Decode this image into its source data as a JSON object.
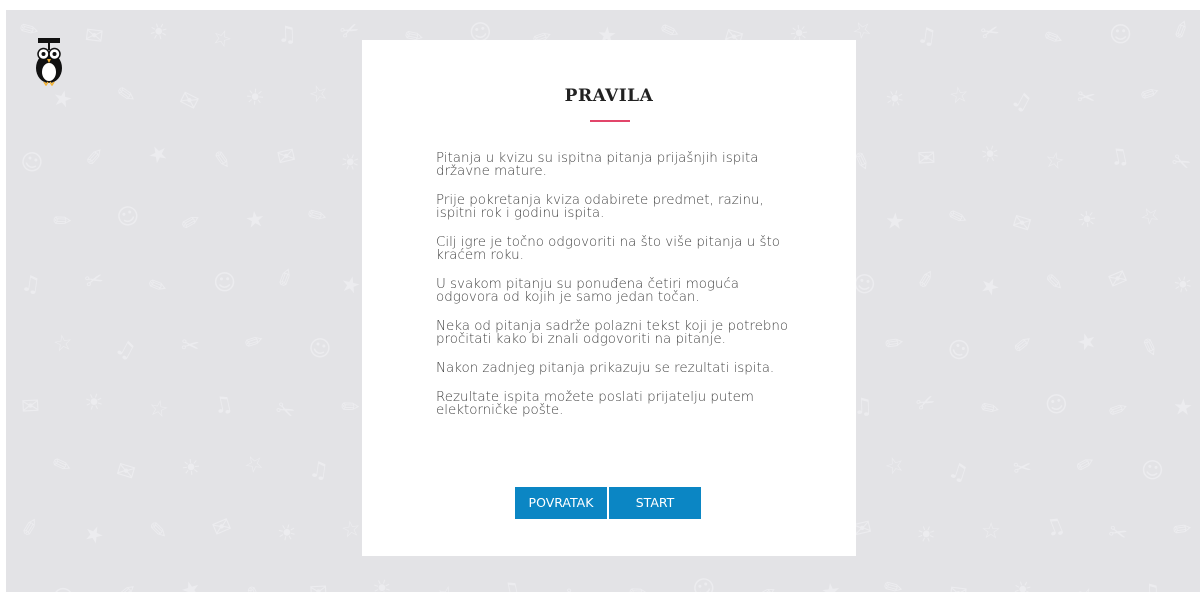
{
  "colors": {
    "background": "#e3e3e6",
    "card": "#ffffff",
    "accent_rule": "#e2456a",
    "button": "#0b86c4",
    "button_text": "#ffffff"
  },
  "logo": {
    "icon": "owl-graduate-icon"
  },
  "background_pattern": {
    "icon": "school-doodles-pattern"
  },
  "rules_panel": {
    "title": "PRAVILA",
    "items": [
      "Pitanja u kvizu su ispitna pitanja prijašnjih ispita državne mature.",
      "Prije pokretanja kviza odabirete predmet, razinu, ispitni rok i godinu ispita.",
      "Cilj igre je točno odgovoriti na što više pitanja u što kraćem roku.",
      "U svakom pitanju su ponuđena četiri moguća odgovora od kojih je samo jedan točan.",
      "Neka od pitanja sadrže polazni tekst koji je potrebno pročitati kako bi znali odgovoriti na pitanje.",
      "Nakon zadnjeg pitanja prikazuju se rezultati ispita.",
      "Rezultate ispita možete poslati prijatelju putem elektorničke pošte."
    ],
    "back_button": "POVRATAK",
    "start_button": "START"
  }
}
